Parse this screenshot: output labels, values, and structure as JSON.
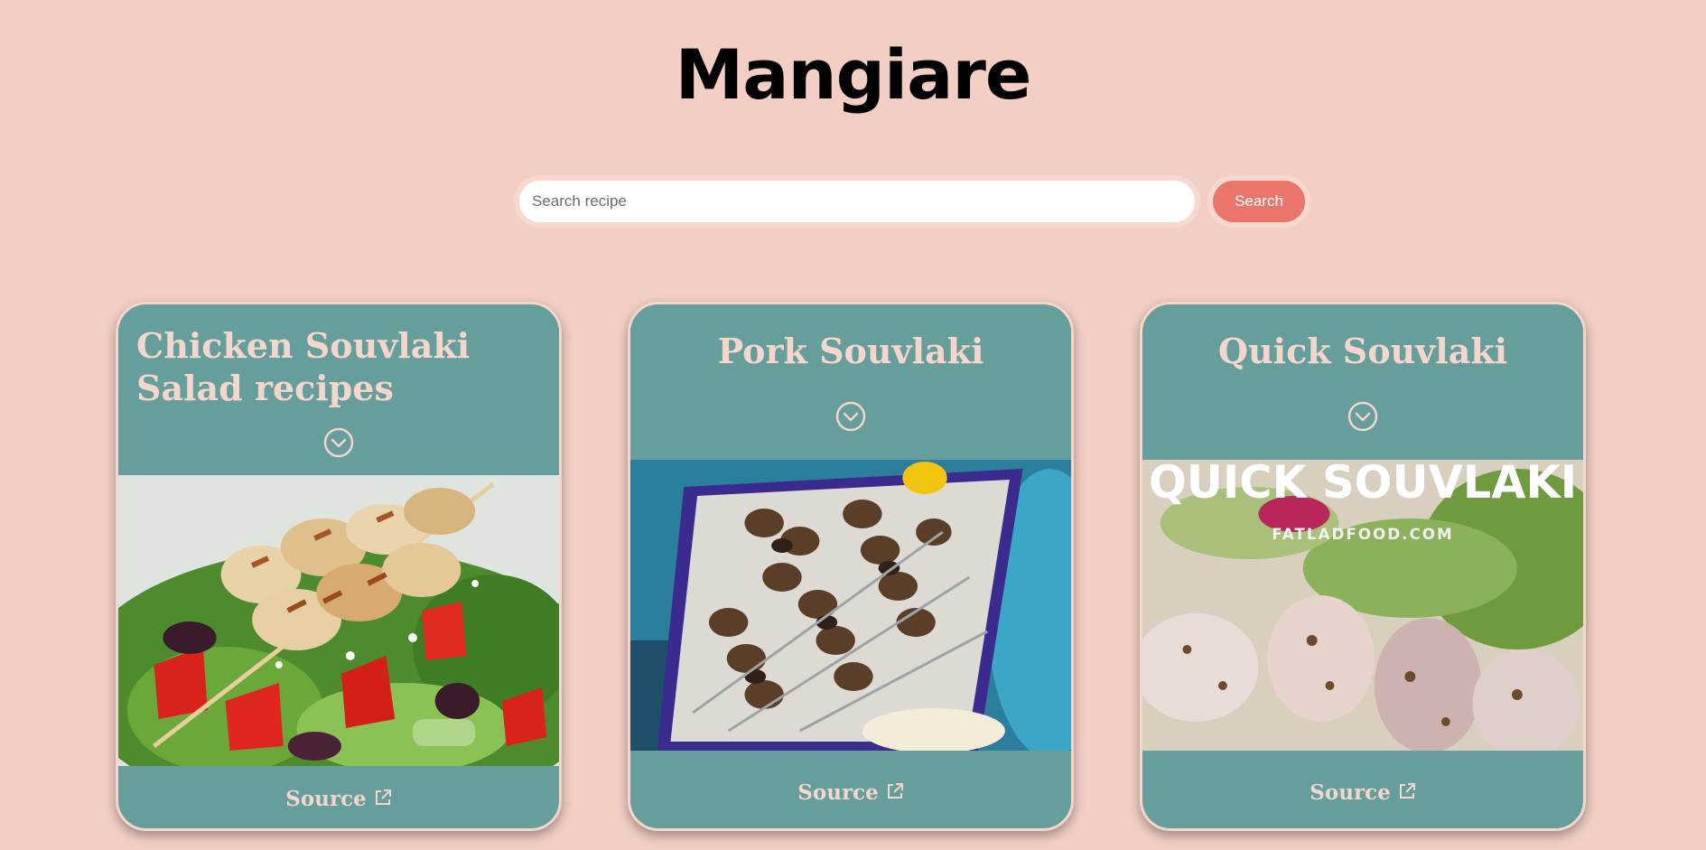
{
  "header": {
    "logo": "Mangiare"
  },
  "search": {
    "placeholder": "Search recipe",
    "value": "",
    "button_label": "Search"
  },
  "colors": {
    "background": "#f2cec5",
    "card": "#659e9b",
    "card_text": "#f4d6cc",
    "button": "#e9756b"
  },
  "recipes": [
    {
      "title": "Chicken Souvlaki Salad recipes",
      "expand_icon": "chevron-circle-down-icon",
      "image": "chicken-souvlaki-salad-photo",
      "source_label": "Source",
      "source_icon": "external-link-icon"
    },
    {
      "title": "Pork Souvlaki",
      "expand_icon": "chevron-circle-down-icon",
      "image": "pork-souvlaki-skewers-photo",
      "source_label": "Source",
      "source_icon": "external-link-icon"
    },
    {
      "title": "Quick Souvlaki",
      "expand_icon": "chevron-circle-down-icon",
      "image": "quick-souvlaki-photo",
      "source_label": "Source",
      "source_icon": "external-link-icon",
      "image_text": "QUICK SOUVLAKI",
      "image_subtext": "FATLADFOOD.COM"
    }
  ]
}
